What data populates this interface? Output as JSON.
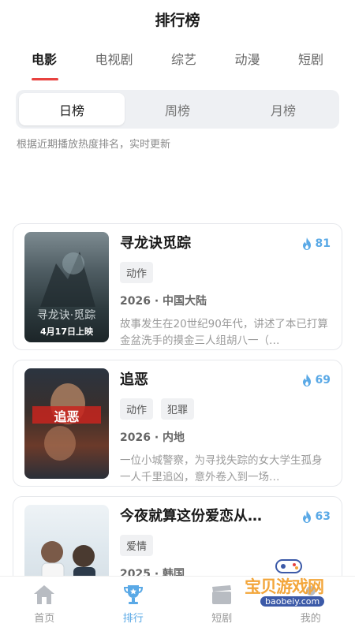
{
  "header": {
    "title": "排行榜"
  },
  "category_tabs": [
    {
      "label": "电影",
      "active": true
    },
    {
      "label": "电视剧",
      "active": false
    },
    {
      "label": "综艺",
      "active": false
    },
    {
      "label": "动漫",
      "active": false
    },
    {
      "label": "短剧",
      "active": false
    }
  ],
  "period_tabs": [
    {
      "label": "日榜",
      "active": true
    },
    {
      "label": "周榜",
      "active": false
    },
    {
      "label": "月榜",
      "active": false
    }
  ],
  "subtitle": "根据近期播放热度排名，实时更新",
  "items": [
    {
      "title": "寻龙诀觅踪",
      "heat": "81",
      "tags": [
        "动作"
      ],
      "meta": "2026 · 中国大陆",
      "desc": "故事发生在20世纪90年代，讲述了本已打算金盆洗手的摸金三人组胡八一（…",
      "poster_text": "4月17日上映"
    },
    {
      "title": "追恶",
      "heat": "69",
      "tags": [
        "动作",
        "犯罪"
      ],
      "meta": "2026 · 内地",
      "desc": "一位小城警察，为寻找失踪的女大学生孤身一人千里追凶，意外卷入到一场…",
      "poster_text": "追恶"
    },
    {
      "title": "今夜就算这份爱恋从…",
      "heat": "63",
      "tags": [
        "爱情"
      ],
      "meta": "2025 · 韩国",
      "desc": "",
      "poster_text": ""
    }
  ],
  "bottom_nav": [
    {
      "label": "首页",
      "icon": "home-icon",
      "active": false
    },
    {
      "label": "排行",
      "icon": "trophy-icon",
      "active": true
    },
    {
      "label": "短剧",
      "icon": "clapper-icon",
      "active": false
    },
    {
      "label": "我的",
      "icon": "user-icon",
      "active": false
    }
  ],
  "watermark": {
    "text": "宝贝游戏网",
    "url": "baobeiy.com"
  },
  "colors": {
    "accent_red": "#e8423f",
    "accent_blue": "#5aa9e6"
  }
}
